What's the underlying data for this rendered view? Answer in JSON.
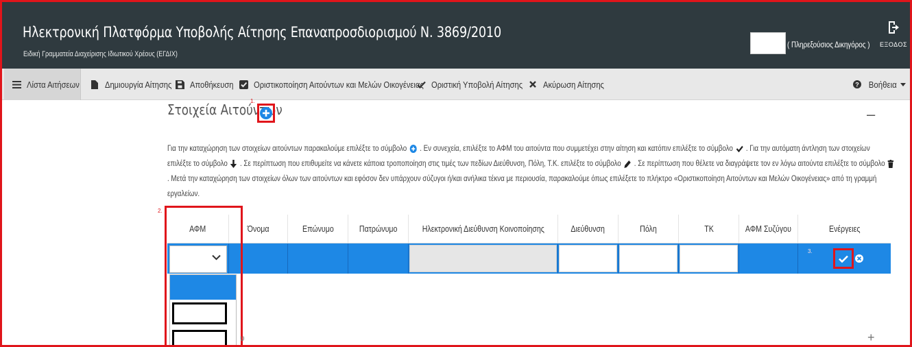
{
  "header": {
    "title": "Ηλεκτρονική Πλατφόρμα Υποβολής Αίτησης Επαναπροσδιορισμού Ν. 3869/2010",
    "subtitle": "Ειδική Γραμματεία Διαχείρισης Ιδιωτικού Χρέους (ΕΓΔΙΧ)",
    "user_role": "( Πληρεξούσιος Δικηγόρος )",
    "logout_label": "ΕΞΟΔΟΣ"
  },
  "toolbar": {
    "list": "Λίστα Αιτήσεων",
    "create": "Δημιουργία Αίτησης",
    "save": "Αποθήκευση",
    "finalize": "Οριστικοποίηση Αιτούντων και Μελών Οικογένειας",
    "submit": "Οριστική Υποβολή Αίτησης",
    "cancel": "Ακύρωση Αίτησης",
    "help": "Βοήθεια"
  },
  "section": {
    "title": "Στοιχεία Αιτούντων",
    "step1": "1.",
    "step2": "2.",
    "step3": "3.",
    "collapse": "–",
    "expand": "+",
    "partial_text": "υ"
  },
  "instructions": {
    "p1": "Για την καταχώρηση των στοιχείων αιτούντων παρακαλούμε επιλέξτε το σύμβολο",
    "p2": ". Εν συνεχεία, επιλέξτε το ΑΦΜ του αιτούντα που συμμετέχει στην αίτηση και κατόπιν επιλέξτε το σύμβολο",
    "p3": ". Για την αυτόματη άντληση των στοιχείων επιλέξτε το σύμβολο",
    "p4": ". Σε περίπτωση που επιθυμείτε να κάνετε κάποια τροποποίηση στις τιμές των πεδίων Διεύθυνση, Πόλη, Τ.Κ. επιλέξτε το σύμβολο",
    "p5": ". Σε περίπτωση που θέλετε να διαγράψετε τον εν λόγω αιτούντα επιλέξτε το σύμβολο",
    "p6": ". Μετά την καταχώρηση των στοιχείων όλων των αιτούντων και εφόσον δεν υπάρχουν σύζυγοι ή/και ανήλικα τέκνα με περιουσία, παρακαλούμε όπως επιλέξετε το πλήκτρο «Οριστικοποίηση Αιτούντων και Μελών Οικογένειας» από τη γραμμή εργαλείων."
  },
  "table": {
    "headers": [
      "ΑΦΜ",
      "Όνομα",
      "Επώνυμο",
      "Πατρώνυμο",
      "Ηλεκτρονική Διεύθυνση Κοινοποίησης",
      "Διεύθυνση",
      "Πόλη",
      "ΤΚ",
      "ΑΦΜ Συζύγου",
      "Ενέργειες"
    ]
  },
  "colors": {
    "header_bg": "#2f3a3f",
    "accent": "#1e88e5",
    "highlight": "#e0151b"
  }
}
